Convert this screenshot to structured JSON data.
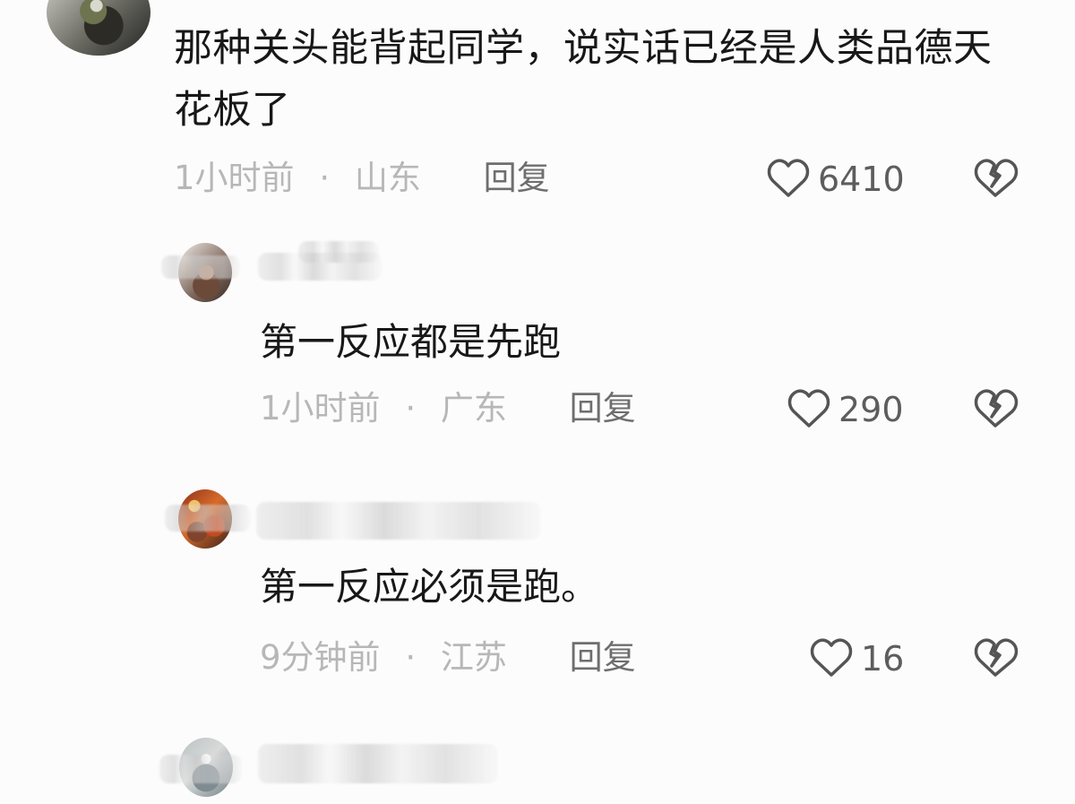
{
  "main_comment": {
    "content": "那种关头能背起同学，说实话已经是人类品德天花板了",
    "time": "1小时前",
    "location": "山东",
    "reply_label": "回复",
    "likes": "6410",
    "like_icon": "heart-outline-icon",
    "dislike_icon": "broken-heart-icon"
  },
  "replies": [
    {
      "content": "第一反应都是先跑",
      "time": "1小时前",
      "location": "广东",
      "reply_label": "回复",
      "likes": "290"
    },
    {
      "content": "第一反应必须是跑。",
      "time": "9分钟前",
      "location": "江苏",
      "reply_label": "回复",
      "likes": "16"
    }
  ],
  "separator": "·",
  "colors": {
    "background": "#fcfcfc",
    "primary_text": "#181818",
    "meta_text": "#b7b7b7",
    "action_text": "#6e6e6e",
    "icon_stroke": "#555555"
  }
}
